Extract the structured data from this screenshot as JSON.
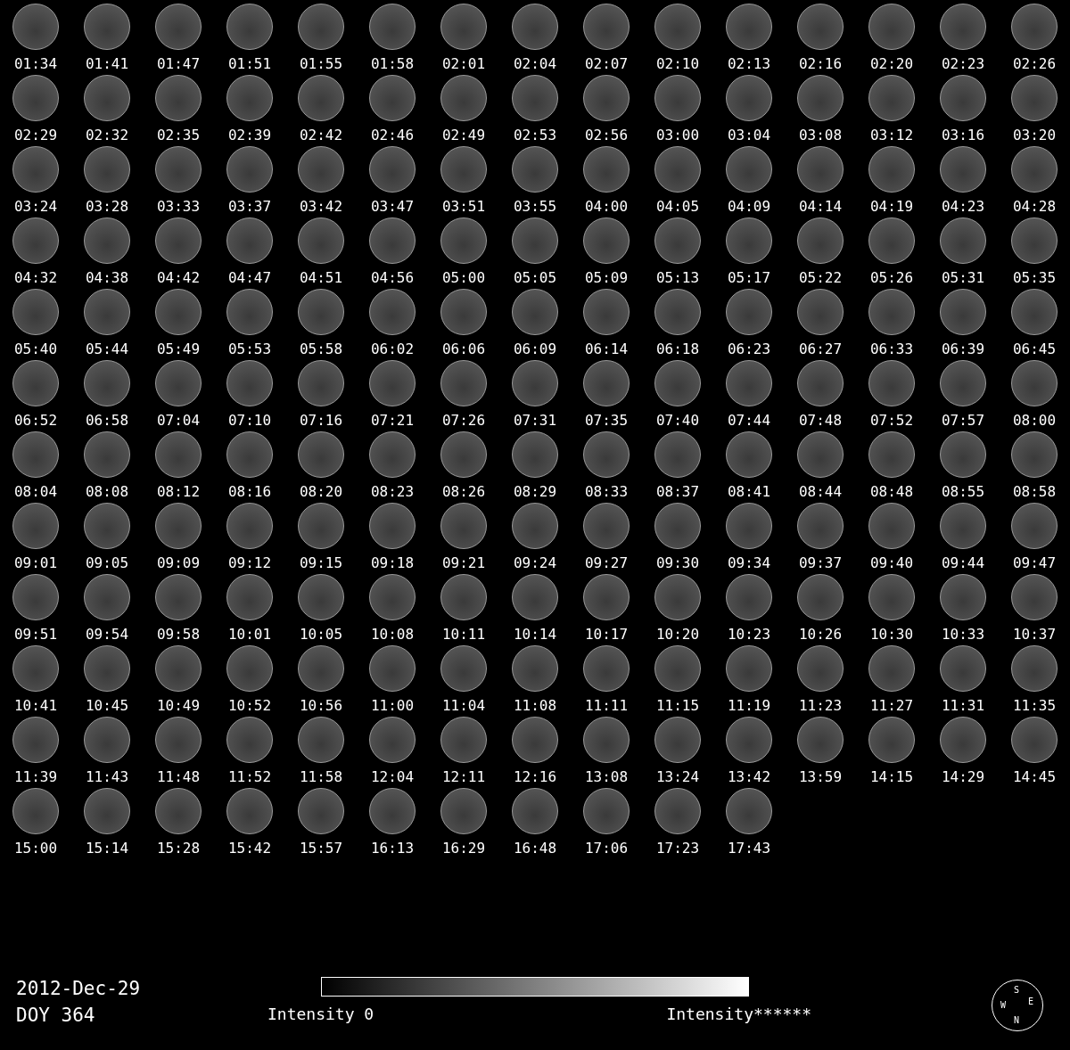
{
  "frames": [
    "01:34",
    "01:41",
    "01:47",
    "01:51",
    "01:55",
    "01:58",
    "02:01",
    "02:04",
    "02:07",
    "02:10",
    "02:13",
    "02:16",
    "02:20",
    "02:23",
    "02:26",
    "02:29",
    "02:32",
    "02:35",
    "02:39",
    "02:42",
    "02:46",
    "02:49",
    "02:53",
    "02:56",
    "03:00",
    "03:04",
    "03:08",
    "03:12",
    "03:16",
    "03:20",
    "03:24",
    "03:28",
    "03:33",
    "03:37",
    "03:42",
    "03:47",
    "03:51",
    "03:55",
    "04:00",
    "04:05",
    "04:09",
    "04:14",
    "04:19",
    "04:23",
    "04:28",
    "04:32",
    "04:38",
    "04:42",
    "04:47",
    "04:51",
    "04:56",
    "05:00",
    "05:05",
    "05:09",
    "05:13",
    "05:17",
    "05:22",
    "05:26",
    "05:31",
    "05:35",
    "05:40",
    "05:44",
    "05:49",
    "05:53",
    "05:58",
    "06:02",
    "06:06",
    "06:09",
    "06:14",
    "06:18",
    "06:23",
    "06:27",
    "06:33",
    "06:39",
    "06:45",
    "06:52",
    "06:58",
    "07:04",
    "07:10",
    "07:16",
    "07:21",
    "07:26",
    "07:31",
    "07:35",
    "07:40",
    "07:44",
    "07:48",
    "07:52",
    "07:57",
    "08:00",
    "08:04",
    "08:08",
    "08:12",
    "08:16",
    "08:20",
    "08:23",
    "08:26",
    "08:29",
    "08:33",
    "08:37",
    "08:41",
    "08:44",
    "08:48",
    "08:55",
    "08:58",
    "09:01",
    "09:05",
    "09:09",
    "09:12",
    "09:15",
    "09:18",
    "09:21",
    "09:24",
    "09:27",
    "09:30",
    "09:34",
    "09:37",
    "09:40",
    "09:44",
    "09:47",
    "09:51",
    "09:54",
    "09:58",
    "10:01",
    "10:05",
    "10:08",
    "10:11",
    "10:14",
    "10:17",
    "10:20",
    "10:23",
    "10:26",
    "10:30",
    "10:33",
    "10:37",
    "10:41",
    "10:45",
    "10:49",
    "10:52",
    "10:56",
    "11:00",
    "11:04",
    "11:08",
    "11:11",
    "11:15",
    "11:19",
    "11:23",
    "11:27",
    "11:31",
    "11:35",
    "11:39",
    "11:43",
    "11:48",
    "11:52",
    "11:58",
    "12:04",
    "12:11",
    "12:16",
    "13:08",
    "13:24",
    "13:42",
    "13:59",
    "14:15",
    "14:29",
    "14:45",
    "15:00",
    "15:14",
    "15:28",
    "15:42",
    "15:57",
    "16:13",
    "16:29",
    "16:48",
    "17:06",
    "17:23",
    "17:43"
  ],
  "date": "2012-Dec-29",
  "doy": "DOY 364",
  "scale": {
    "min_label": "Intensity 0",
    "max_label": "Intensity******"
  },
  "compass": {
    "top": "S",
    "left": "W",
    "right": "E",
    "bottom": "N"
  }
}
